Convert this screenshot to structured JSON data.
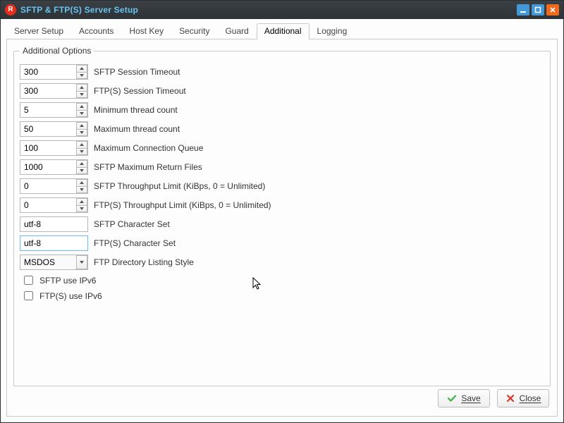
{
  "window": {
    "title": "SFTP & FTP(S) Server Setup"
  },
  "tabs": [
    "Server Setup",
    "Accounts",
    "Host Key",
    "Security",
    "Guard",
    "Additional",
    "Logging"
  ],
  "active_tab": 5,
  "group": {
    "legend": "Additional Options"
  },
  "fields": {
    "sftp_timeout": {
      "value": "300",
      "label": "SFTP Session Timeout"
    },
    "ftps_timeout": {
      "value": "300",
      "label": "FTP(S) Session Timeout"
    },
    "min_threads": {
      "value": "5",
      "label": "Minimum thread count"
    },
    "max_threads": {
      "value": "50",
      "label": "Maximum thread count"
    },
    "max_conn_queue": {
      "value": "100",
      "label": "Maximum Connection Queue"
    },
    "sftp_max_return": {
      "value": "1000",
      "label": "SFTP Maximum Return Files"
    },
    "sftp_throughput": {
      "value": "0",
      "label": "SFTP Throughput Limit (KiBps, 0 = Unlimited)"
    },
    "ftps_throughput": {
      "value": "0",
      "label": "FTP(S) Throughput Limit (KiBps, 0 = Unlimited)"
    },
    "sftp_charset": {
      "value": "utf-8",
      "label": "SFTP Character Set"
    },
    "ftps_charset": {
      "value": "utf-8",
      "label": "FTP(S) Character Set"
    },
    "ftp_dirstyle": {
      "value": "MSDOS",
      "label": "FTP Directory Listing Style"
    }
  },
  "checks": {
    "sftp_ipv6": {
      "checked": false,
      "label": "SFTP use IPv6"
    },
    "ftps_ipv6": {
      "checked": false,
      "label": "FTP(S) use IPv6"
    }
  },
  "buttons": {
    "save": "Save",
    "close": "Close"
  }
}
